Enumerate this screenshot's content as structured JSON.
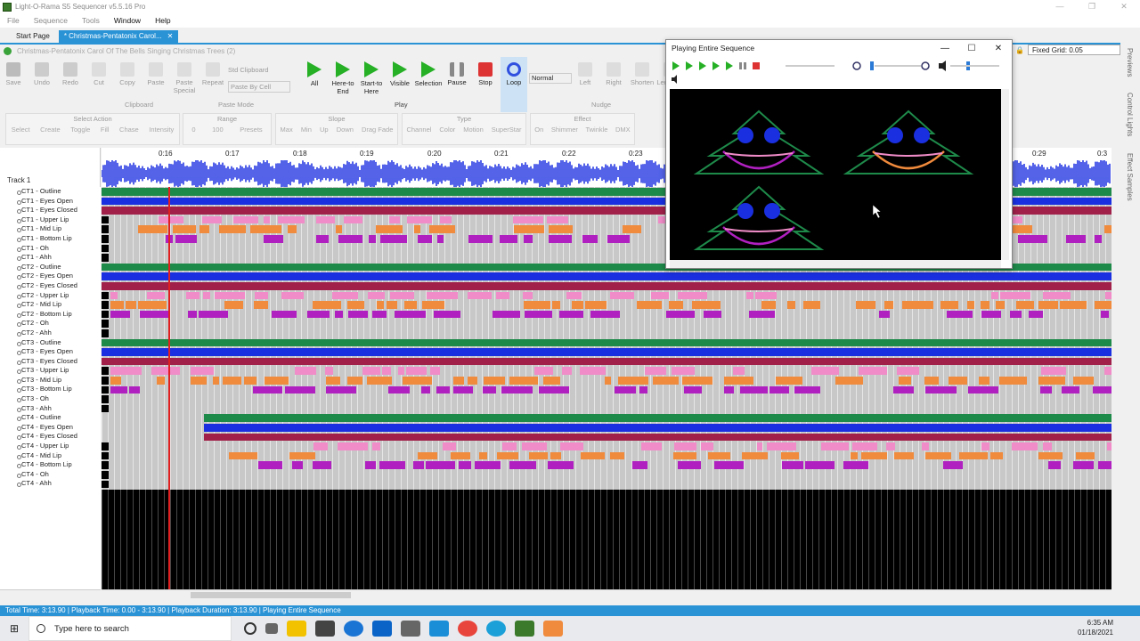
{
  "window": {
    "title": "Light-O-Rama S5 Sequencer v5.5.16 Pro",
    "controls": [
      "—",
      "❐",
      "✕"
    ]
  },
  "menu": [
    "File",
    "Sequence",
    "Tools",
    "Window",
    "Help"
  ],
  "tabs": [
    {
      "label": "Start Page"
    },
    {
      "label": "* Christmas-Pentatonix Carol...",
      "close": "✕"
    }
  ],
  "document": {
    "title": "Christmas-Pentatonix Carol Of The Bells Singing Christmas Trees (2)"
  },
  "ribbon": {
    "clipboard": {
      "items": [
        "Save",
        "Undo",
        "Redo",
        "Cut",
        "Copy",
        "Paste",
        "Paste Special",
        "Repeat"
      ],
      "std": "Std Clipboard",
      "paste_by": "Paste By Cell",
      "group": "Clipboard",
      "mode_group": "Paste Mode"
    },
    "play": {
      "items": [
        "All",
        "Here-to End",
        "Start-to Here",
        "Visible",
        "Selection",
        "Pause",
        "Stop",
        "Loop"
      ],
      "speed": "Normal",
      "group": "Play"
    },
    "nudge": {
      "items": [
        "Left",
        "Right",
        "Shorten",
        "Lengthen",
        "Drag Edge"
      ],
      "group": "Nudge"
    }
  },
  "ribbon2": {
    "select_action": {
      "title": "Select Action",
      "items": [
        "Select",
        "Create",
        "Toggle",
        "Fill",
        "Chase",
        "Intensity"
      ]
    },
    "range": {
      "title": "Range",
      "from": "0",
      "to": "100",
      "presets": "Presets"
    },
    "slope": {
      "title": "Slope",
      "items": [
        "Max",
        "Min",
        "Up",
        "Down",
        "Drag Fade"
      ]
    },
    "type": {
      "title": "Type",
      "items": [
        "Channel",
        "Color",
        "Motion",
        "SuperStar"
      ]
    },
    "effect": {
      "title": "Effect",
      "items": [
        "On",
        "Shimmer",
        "Twinkle",
        "DMX"
      ]
    }
  },
  "fixed_grid": "Fixed Grid: 0.05",
  "track": "Track 1",
  "timeline": [
    "0:16",
    "0:17",
    "0:18",
    "0:19",
    "0:20",
    "0:21",
    "0:22",
    "0:23",
    "0:29",
    "0:3"
  ],
  "channels": [
    "CT1 - Outline",
    "CT1 - Eyes Open",
    "CT1 - Eyes Closed",
    "CT1 - Upper Lip",
    "CT1 - Mid Lip",
    "CT1 - Bottom Lip",
    "CT1 - Oh",
    "CT1 - Ahh",
    "CT2 - Outline",
    "CT2 - Eyes Open",
    "CT2 - Eyes Closed",
    "CT2 - Upper Lip",
    "CT2 - Mid Lip",
    "CT2 - Bottom Lip",
    "CT2 - Oh",
    "CT2 - Ahh",
    "CT3 - Outline",
    "CT3 - Eyes Open",
    "CT3 - Eyes Closed",
    "CT3 - Upper Lip",
    "CT3 - Mid Lip",
    "CT3 - Bottom Lip",
    "CT3 - Oh",
    "CT3 - Ahh",
    "CT4 - Outline",
    "CT4 - Eyes Open",
    "CT4 - Eyes Closed",
    "CT4 - Upper Lip",
    "CT4 - Mid Lip",
    "CT4 - Bottom Lip",
    "CT4 - Oh",
    "CT4 - Ahh"
  ],
  "colors": {
    "outline": "#1e8a4a",
    "eyes_open": "#1a2fe0",
    "eyes_closed": "#a0204a",
    "upper_lip": "#f08cc8",
    "mid_lip": "#f08a3c",
    "bottom_lip": "#b020c0",
    "accent": "#2a93d6"
  },
  "preview": {
    "title": "Playing Entire Sequence",
    "controls": [
      "—",
      "☐",
      "✕"
    ]
  },
  "sidepanel": [
    "Previews",
    "Control Lights",
    "Effect Samples"
  ],
  "status": "Total Time: 3:13.90 | Playback Time: 0.00 - 3:13.90 | Playback Duration: 3:13.90 | Playing Entire Sequence",
  "taskbar": {
    "search_placeholder": "Type here to search",
    "time": "6:35 AM",
    "date": "01/18/2021"
  }
}
